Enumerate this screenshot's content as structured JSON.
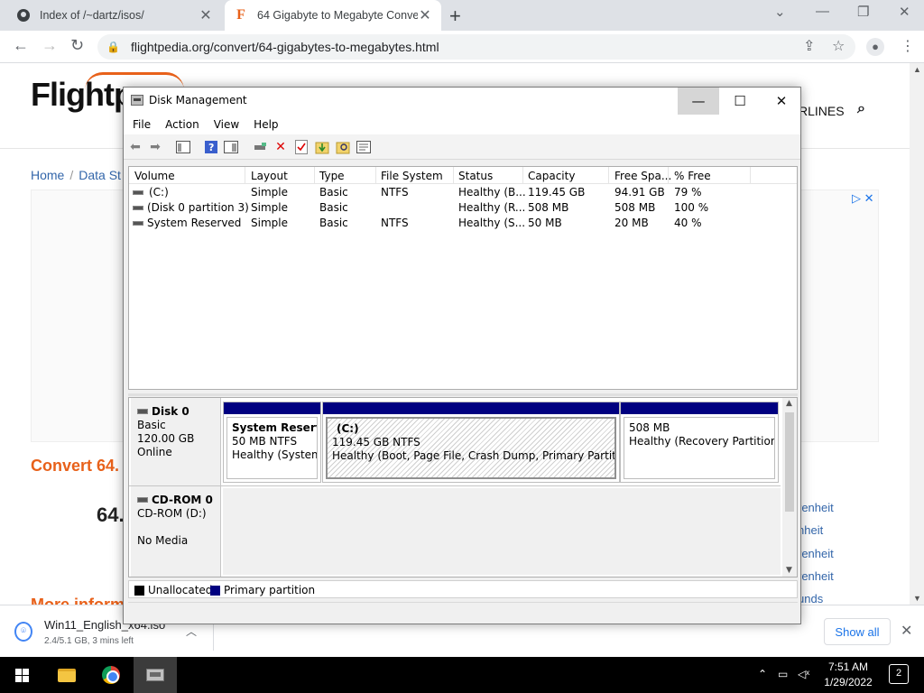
{
  "browser": {
    "tabs": [
      {
        "title": "Index of /~dartz/isos/",
        "active": false
      },
      {
        "title": "64 Gigabyte to Megabyte Conve",
        "active": true
      }
    ],
    "url": "flightpedia.org/convert/64-gigabytes-to-megabytes.html"
  },
  "webpage": {
    "logo": "Flightpe",
    "nav_text": "RLINES",
    "breadcrumbs": [
      "Home",
      "Data St"
    ],
    "convert_title": "Convert 64.",
    "big_value": "64.",
    "right_links": [
      "renheit",
      "nheit",
      "renheit",
      "renheit",
      "unds"
    ],
    "more_info": "More inform"
  },
  "disk_management": {
    "title": "Disk Management",
    "menu": [
      "File",
      "Action",
      "View",
      "Help"
    ],
    "volume_columns": [
      "Volume",
      "Layout",
      "Type",
      "File System",
      "Status",
      "Capacity",
      "Free Spa...",
      "% Free"
    ],
    "volumes": [
      {
        "volume": "(C:)",
        "layout": "Simple",
        "type": "Basic",
        "fs": "NTFS",
        "status": "Healthy (B...",
        "capacity": "119.45 GB",
        "free": "94.91 GB",
        "pct": "79 %"
      },
      {
        "volume": "(Disk 0 partition 3)",
        "layout": "Simple",
        "type": "Basic",
        "fs": "",
        "status": "Healthy (R...",
        "capacity": "508 MB",
        "free": "508 MB",
        "pct": "100 %"
      },
      {
        "volume": "System Reserved",
        "layout": "Simple",
        "type": "Basic",
        "fs": "NTFS",
        "status": "Healthy (S...",
        "capacity": "50 MB",
        "free": "20 MB",
        "pct": "40 %"
      }
    ],
    "disk0": {
      "name": "Disk 0",
      "type": "Basic",
      "size": "120.00 GB",
      "state": "Online",
      "partitions": [
        {
          "name": "System Reserved",
          "size": "50 MB NTFS",
          "status": "Healthy (System, A"
        },
        {
          "name": "(C:)",
          "size": "119.45 GB NTFS",
          "status": "Healthy (Boot, Page File, Crash Dump, Primary Partition)"
        },
        {
          "name": "",
          "size": "508 MB",
          "status": "Healthy (Recovery Partition)"
        }
      ]
    },
    "cdrom": {
      "name": "CD-ROM 0",
      "drive": "CD-ROM (D:)",
      "media": "No Media"
    },
    "legend": [
      {
        "label": "Unallocated",
        "color": "#000000"
      },
      {
        "label": "Primary partition",
        "color": "#000080"
      }
    ]
  },
  "downloads": {
    "file": "Win11_English_x64.iso",
    "status": "2.4/5.1 GB, 3 mins left",
    "show_all": "Show all"
  },
  "taskbar": {
    "time": "7:51 AM",
    "date": "1/29/2022",
    "notifications": "2"
  }
}
